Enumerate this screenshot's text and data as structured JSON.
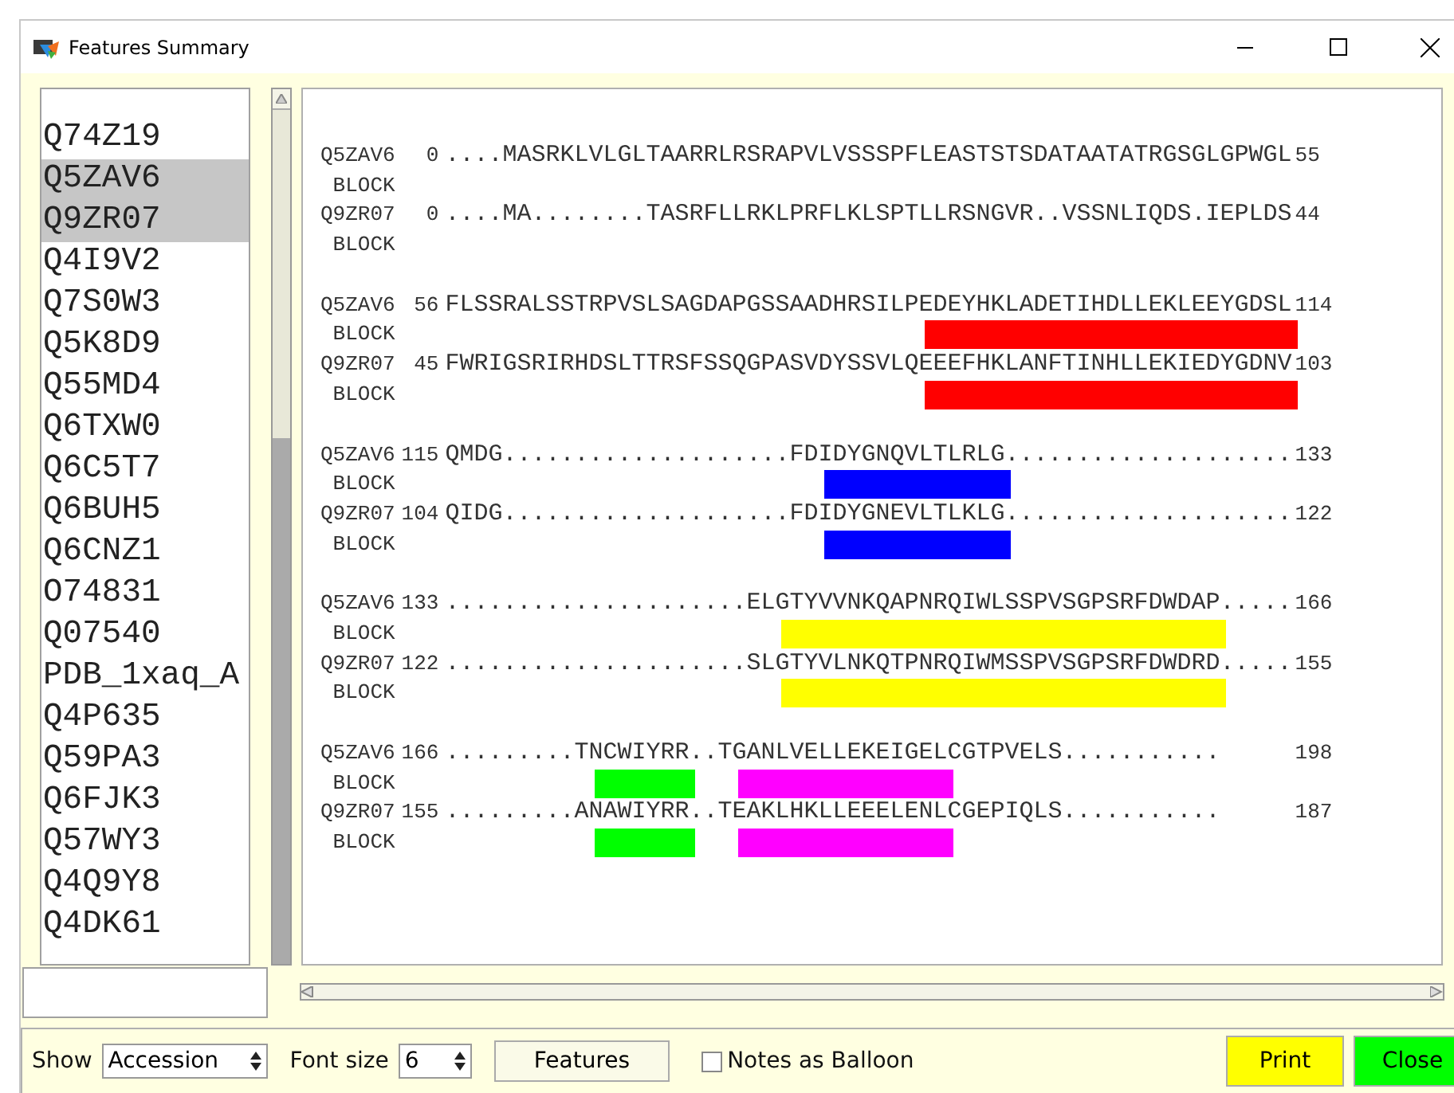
{
  "window": {
    "title": "Features Summary"
  },
  "list": {
    "items": [
      {
        "label": "Q74Z19",
        "selected": false
      },
      {
        "label": "Q5ZAV6",
        "selected": true
      },
      {
        "label": "Q9ZR07",
        "selected": true
      },
      {
        "label": "Q4I9V2",
        "selected": false
      },
      {
        "label": "Q7S0W3",
        "selected": false
      },
      {
        "label": "Q5K8D9",
        "selected": false
      },
      {
        "label": "Q55MD4",
        "selected": false
      },
      {
        "label": "Q6TXW0",
        "selected": false
      },
      {
        "label": "Q6C5T7",
        "selected": false
      },
      {
        "label": "Q6BUH5",
        "selected": false
      },
      {
        "label": "Q6CNZ1",
        "selected": false
      },
      {
        "label": "O74831",
        "selected": false
      },
      {
        "label": "Q07540",
        "selected": false
      },
      {
        "label": "PDB_1xaq_A",
        "selected": false
      },
      {
        "label": "Q4P635",
        "selected": false
      },
      {
        "label": "Q59PA3",
        "selected": false
      },
      {
        "label": "Q6FJK3",
        "selected": false
      },
      {
        "label": "Q57WY3",
        "selected": false
      },
      {
        "label": "Q4Q9Y8",
        "selected": false
      },
      {
        "label": "Q4DK61",
        "selected": false
      }
    ]
  },
  "alignment": {
    "blocks": [
      {
        "rows": [
          {
            "name": "Q5ZAV6",
            "start": "0",
            "sequence": "....MASRKLVLGLTAARRLRSRAPVLVSSSPFLEASTSTSDATAATATRGSGLGPWGL",
            "end": "55",
            "feature_label": "BLOCK",
            "features": []
          },
          {
            "name": "Q9ZR07",
            "start": "0",
            "sequence": "....MA........TASRFLLRKLPRFLKLSPTLLRSNGVR..VSSNLIQDS.IEPLDS",
            "end": "44",
            "feature_label": "BLOCK",
            "features": []
          }
        ]
      },
      {
        "rows": [
          {
            "name": "Q5ZAV6",
            "start": "56",
            "sequence": "FLSSRALSSTRPVSLSAGDAPGSSAADHRSILPEDEYHKLADETIHDLLEKLEEYGDSL",
            "end": "114",
            "feature_label": "BLOCK",
            "features": [
              {
                "color": "#ff0000"
              }
            ]
          },
          {
            "name": "Q9ZR07",
            "start": "45",
            "sequence": "FWRIGSRIRHDSLTTRSFSSQGPASVDYSSVLQEEEFHKLANFTINHLLEKIEDYGDNV",
            "end": "103",
            "feature_label": "BLOCK",
            "features": [
              {
                "color": "#ff0000"
              }
            ]
          }
        ]
      },
      {
        "rows": [
          {
            "name": "Q5ZAV6",
            "start": "115",
            "sequence": "QMDG....................FDIDYGNQVLTLRLG....................",
            "end": "133",
            "feature_label": "BLOCK",
            "features": [
              {
                "color": "#0000ff"
              }
            ]
          },
          {
            "name": "Q9ZR07",
            "start": "104",
            "sequence": "QIDG....................FDIDYGNEVLTLKLG....................",
            "end": "122",
            "feature_label": "BLOCK",
            "features": [
              {
                "color": "#0000ff"
              }
            ]
          }
        ]
      },
      {
        "rows": [
          {
            "name": "Q5ZAV6",
            "start": "133",
            "sequence": ".....................ELGTYVVNKQAPNRQIWLSSPVSGPSRFDWDAP.....",
            "end": "166",
            "feature_label": "BLOCK",
            "features": [
              {
                "color": "#ffff00"
              }
            ]
          },
          {
            "name": "Q9ZR07",
            "start": "122",
            "sequence": ".....................SLGTYVLNKQTPNRQIWMSSPVSGPSRFDWDRD.....",
            "end": "155",
            "feature_label": "BLOCK",
            "features": [
              {
                "color": "#ffff00"
              }
            ]
          }
        ]
      },
      {
        "rows": [
          {
            "name": "Q5ZAV6",
            "start": "166",
            "sequence": ".........TNCWIYRR..TGANLVELLEKEIGELCGTPVELS...........",
            "end": "198",
            "feature_label": "BLOCK",
            "features": [
              {
                "color": "#00ff00"
              },
              {
                "color": "#ff00ff"
              }
            ]
          },
          {
            "name": "Q9ZR07",
            "start": "155",
            "sequence": ".........ANAWIYRR..TEAKLHKLLEEELENLCGEPIQLS...........",
            "end": "187",
            "feature_label": "BLOCK",
            "features": [
              {
                "color": "#00ff00"
              },
              {
                "color": "#ff00ff"
              }
            ]
          }
        ]
      }
    ]
  },
  "toolbar": {
    "show_label": "Show",
    "show_value": "Accession",
    "font_size_label": "Font size",
    "font_size_value": "6",
    "features_button": "Features",
    "notes_checkbox": {
      "label": "Notes as Balloon",
      "checked": false
    },
    "print_button": "Print",
    "close_button": "Close"
  }
}
